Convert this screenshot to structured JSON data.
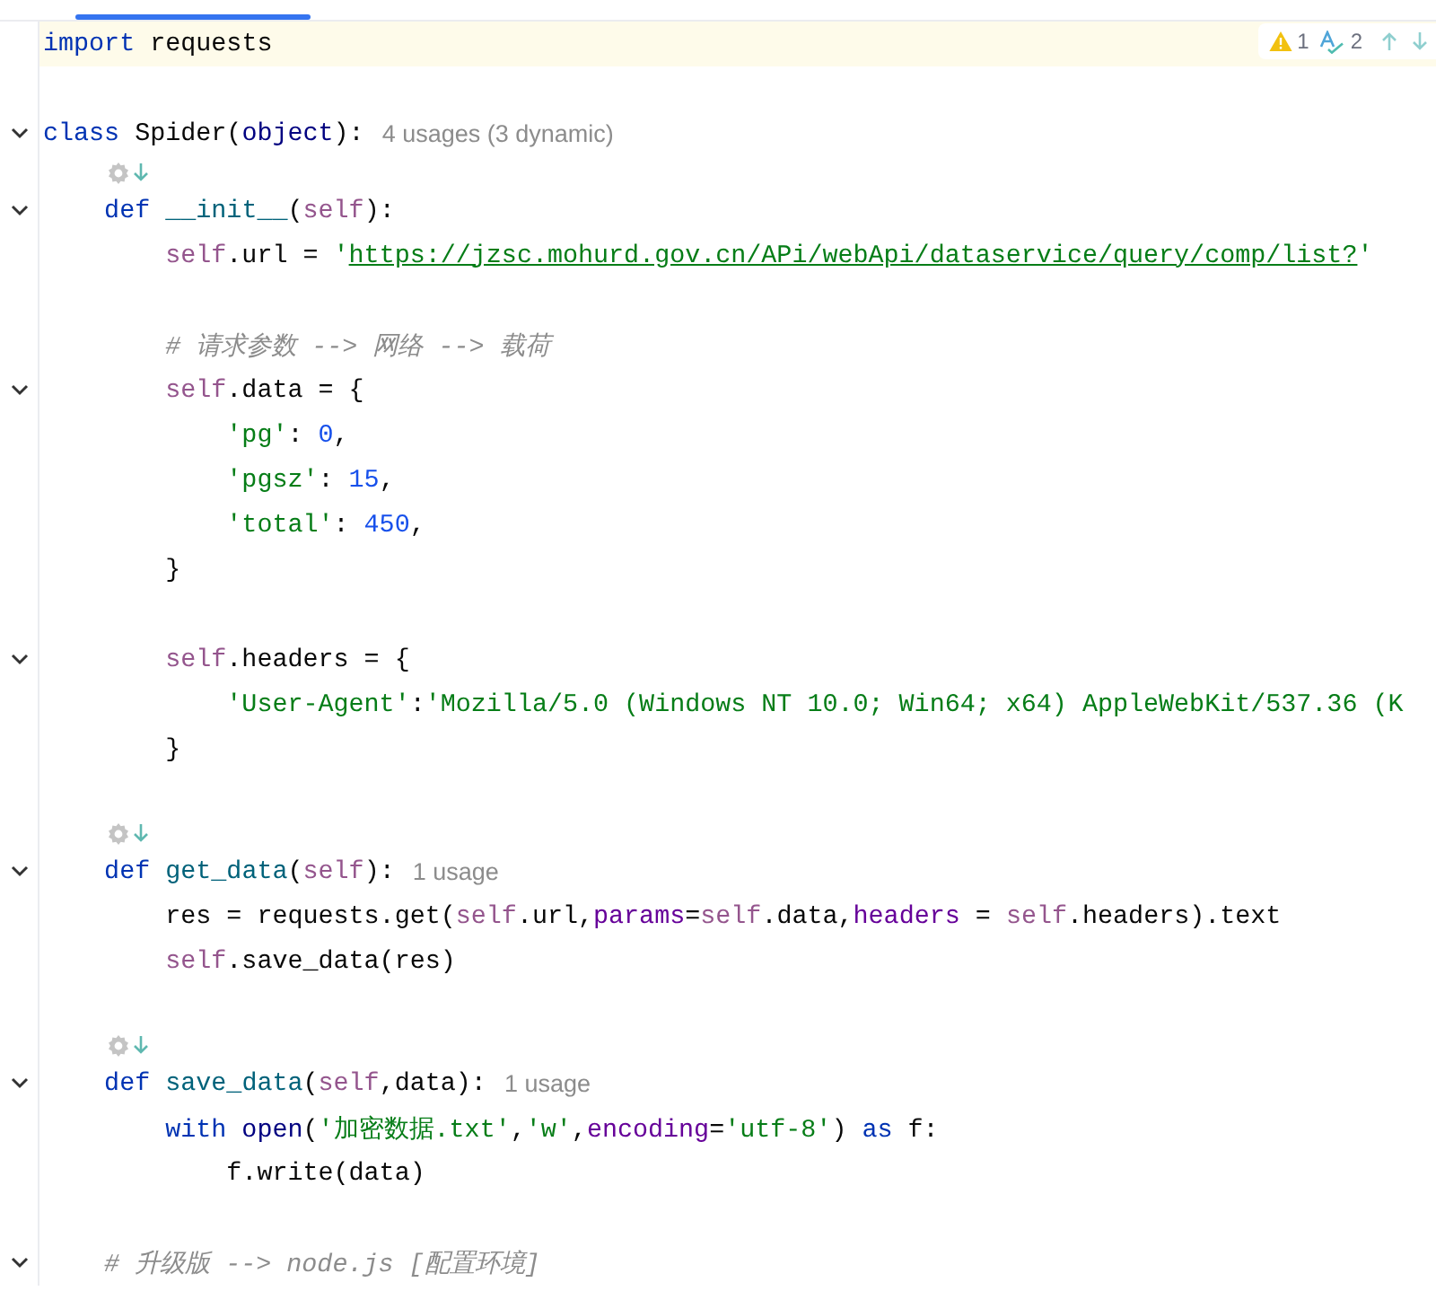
{
  "inspections": {
    "warnings": "1",
    "typos": "2"
  },
  "lines": [
    {
      "kind": "code",
      "fold": false,
      "current": true,
      "tokens": [
        {
          "kind": "kw",
          "t": "import"
        },
        {
          "kind": "txt",
          "t": " requests"
        }
      ]
    },
    {
      "kind": "blank"
    },
    {
      "kind": "code",
      "fold": true,
      "current": false,
      "hint": "4 usages (3 dynamic)",
      "tokens": [
        {
          "kind": "kw",
          "t": "class"
        },
        {
          "kind": "txt",
          "t": " Spider("
        },
        {
          "kind": "builtin",
          "t": "object"
        },
        {
          "kind": "txt",
          "t": "):"
        }
      ]
    },
    {
      "kind": "icons"
    },
    {
      "kind": "code",
      "fold": true,
      "current": false,
      "tokens": [
        {
          "kind": "kw",
          "t": "    def"
        },
        {
          "kind": "fn",
          "t": " __init__"
        },
        {
          "kind": "txt",
          "t": "("
        },
        {
          "kind": "self",
          "t": "self"
        },
        {
          "kind": "txt",
          "t": "):"
        }
      ]
    },
    {
      "kind": "code",
      "fold": false,
      "current": false,
      "tokens": [
        {
          "kind": "self",
          "t": "        self"
        },
        {
          "kind": "txt",
          "t": ".url = "
        },
        {
          "kind": "str",
          "t": "'"
        },
        {
          "kind": "url",
          "t": "https://jzsc.mohurd.gov.cn/APi/webApi/dataservice/query/comp/list?"
        },
        {
          "kind": "str",
          "t": "'"
        }
      ]
    },
    {
      "kind": "blank"
    },
    {
      "kind": "code",
      "fold": false,
      "current": false,
      "tokens": [
        {
          "kind": "com",
          "t": "        # 请求参数 --> 网络 --> 载荷"
        }
      ]
    },
    {
      "kind": "code",
      "fold": true,
      "current": false,
      "tokens": [
        {
          "kind": "self",
          "t": "        self"
        },
        {
          "kind": "txt",
          "t": ".data = {"
        }
      ]
    },
    {
      "kind": "code",
      "fold": false,
      "current": false,
      "tokens": [
        {
          "kind": "str",
          "t": "            'pg'"
        },
        {
          "kind": "txt",
          "t": ": "
        },
        {
          "kind": "num",
          "t": "0"
        },
        {
          "kind": "txt",
          "t": ","
        }
      ]
    },
    {
      "kind": "code",
      "fold": false,
      "current": false,
      "tokens": [
        {
          "kind": "str",
          "t": "            'pgsz'"
        },
        {
          "kind": "txt",
          "t": ": "
        },
        {
          "kind": "num",
          "t": "15"
        },
        {
          "kind": "txt",
          "t": ","
        }
      ]
    },
    {
      "kind": "code",
      "fold": false,
      "current": false,
      "tokens": [
        {
          "kind": "str",
          "t": "            'total'"
        },
        {
          "kind": "txt",
          "t": ": "
        },
        {
          "kind": "num",
          "t": "450"
        },
        {
          "kind": "txt",
          "t": ","
        }
      ]
    },
    {
      "kind": "code",
      "fold": false,
      "current": false,
      "tokens": [
        {
          "kind": "txt",
          "t": "        }"
        }
      ]
    },
    {
      "kind": "blank"
    },
    {
      "kind": "code",
      "fold": true,
      "current": false,
      "tokens": [
        {
          "kind": "self",
          "t": "        self"
        },
        {
          "kind": "txt",
          "t": ".headers = {"
        }
      ]
    },
    {
      "kind": "code",
      "fold": false,
      "current": false,
      "tokens": [
        {
          "kind": "str",
          "t": "            'User-Agent'"
        },
        {
          "kind": "txt",
          "t": ":"
        },
        {
          "kind": "str",
          "t": "'Mozilla/5.0 (Windows NT 10.0; Win64; x64) AppleWebKit/537.36 (K"
        }
      ]
    },
    {
      "kind": "code",
      "fold": false,
      "current": false,
      "tokens": [
        {
          "kind": "txt",
          "t": "        }"
        }
      ]
    },
    {
      "kind": "blank"
    },
    {
      "kind": "icons"
    },
    {
      "kind": "code",
      "fold": true,
      "current": false,
      "hint": "1 usage",
      "tokens": [
        {
          "kind": "kw",
          "t": "    def"
        },
        {
          "kind": "fn",
          "t": " get_data"
        },
        {
          "kind": "txt",
          "t": "("
        },
        {
          "kind": "self",
          "t": "self"
        },
        {
          "kind": "txt",
          "t": "):"
        }
      ]
    },
    {
      "kind": "code",
      "fold": false,
      "current": false,
      "tokens": [
        {
          "kind": "txt",
          "t": "        res = requests.get("
        },
        {
          "kind": "self",
          "t": "self"
        },
        {
          "kind": "txt",
          "t": ".url,"
        },
        {
          "kind": "arg",
          "t": "params"
        },
        {
          "kind": "txt",
          "t": "="
        },
        {
          "kind": "self",
          "t": "self"
        },
        {
          "kind": "txt",
          "t": ".data,"
        },
        {
          "kind": "arg",
          "t": "headers"
        },
        {
          "kind": "txt",
          "t": " = "
        },
        {
          "kind": "self",
          "t": "self"
        },
        {
          "kind": "txt",
          "t": ".headers).text"
        }
      ]
    },
    {
      "kind": "code",
      "fold": false,
      "current": false,
      "tokens": [
        {
          "kind": "self",
          "t": "        self"
        },
        {
          "kind": "txt",
          "t": ".save_data(res)"
        }
      ]
    },
    {
      "kind": "blank"
    },
    {
      "kind": "icons"
    },
    {
      "kind": "code",
      "fold": true,
      "current": false,
      "hint": "1 usage",
      "tokens": [
        {
          "kind": "kw",
          "t": "    def"
        },
        {
          "kind": "fn",
          "t": " save_data"
        },
        {
          "kind": "txt",
          "t": "("
        },
        {
          "kind": "self",
          "t": "self"
        },
        {
          "kind": "txt",
          "t": ",data):"
        }
      ]
    },
    {
      "kind": "code",
      "fold": false,
      "current": false,
      "tokens": [
        {
          "kind": "kw",
          "t": "        with"
        },
        {
          "kind": "builtin",
          "t": " open"
        },
        {
          "kind": "txt",
          "t": "("
        },
        {
          "kind": "str",
          "t": "'加密数据.txt'"
        },
        {
          "kind": "txt",
          "t": ","
        },
        {
          "kind": "str",
          "t": "'w'"
        },
        {
          "kind": "txt",
          "t": ","
        },
        {
          "kind": "arg",
          "t": "encoding"
        },
        {
          "kind": "txt",
          "t": "="
        },
        {
          "kind": "str",
          "t": "'utf-8'"
        },
        {
          "kind": "txt",
          "t": ") "
        },
        {
          "kind": "kw",
          "t": "as"
        },
        {
          "kind": "txt",
          "t": " f:"
        }
      ]
    },
    {
      "kind": "code",
      "fold": false,
      "current": false,
      "tokens": [
        {
          "kind": "txt",
          "t": "            f.write(data)"
        }
      ]
    },
    {
      "kind": "blank"
    },
    {
      "kind": "code",
      "fold": true,
      "current": false,
      "tokens": [
        {
          "kind": "com",
          "t": "    # 升级版 --> node.js [配置环境]"
        }
      ]
    }
  ]
}
